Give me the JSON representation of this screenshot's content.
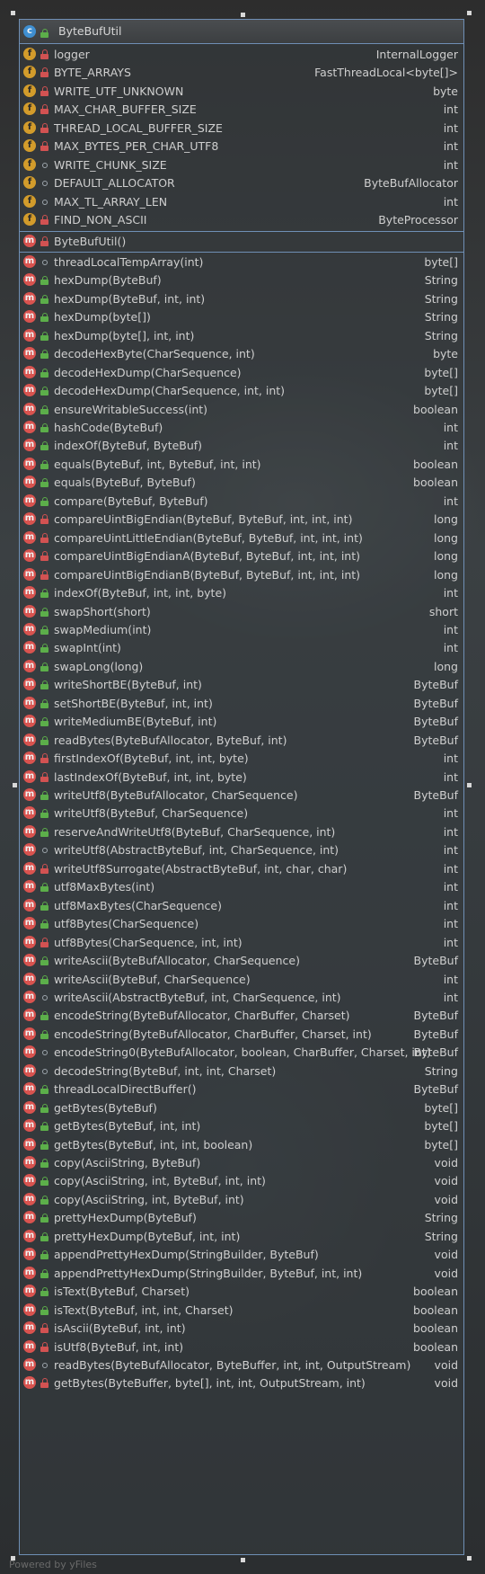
{
  "class_name": "ByteBufUtil",
  "footer_text": "Powered by yFiles",
  "colors": {
    "border": "#6f8fb5",
    "text": "#cfcfcf",
    "field_icon": "#d39c2b",
    "method_icon": "#d9534f",
    "class_icon": "#3f8fd1",
    "public": "#5cae4a",
    "private": "#d25252"
  },
  "fields": [
    {
      "name": "logger",
      "type": "InternalLogger",
      "vis": "private"
    },
    {
      "name": "BYTE_ARRAYS",
      "type": "FastThreadLocal<byte[]>",
      "vis": "private"
    },
    {
      "name": "WRITE_UTF_UNKNOWN",
      "type": "byte",
      "vis": "private"
    },
    {
      "name": "MAX_CHAR_BUFFER_SIZE",
      "type": "int",
      "vis": "private"
    },
    {
      "name": "THREAD_LOCAL_BUFFER_SIZE",
      "type": "int",
      "vis": "private"
    },
    {
      "name": "MAX_BYTES_PER_CHAR_UTF8",
      "type": "int",
      "vis": "private"
    },
    {
      "name": "WRITE_CHUNK_SIZE",
      "type": "int",
      "vis": "package"
    },
    {
      "name": "DEFAULT_ALLOCATOR",
      "type": "ByteBufAllocator",
      "vis": "package"
    },
    {
      "name": "MAX_TL_ARRAY_LEN",
      "type": "int",
      "vis": "package"
    },
    {
      "name": "FIND_NON_ASCII",
      "type": "ByteProcessor",
      "vis": "private"
    }
  ],
  "constructors": [
    {
      "name": "ByteBufUtil()",
      "type": "",
      "vis": "private"
    }
  ],
  "methods": [
    {
      "name": "threadLocalTempArray(int)",
      "type": "byte[]",
      "vis": "package"
    },
    {
      "name": "hexDump(ByteBuf)",
      "type": "String",
      "vis": "public"
    },
    {
      "name": "hexDump(ByteBuf, int, int)",
      "type": "String",
      "vis": "public"
    },
    {
      "name": "hexDump(byte[])",
      "type": "String",
      "vis": "public"
    },
    {
      "name": "hexDump(byte[], int, int)",
      "type": "String",
      "vis": "public"
    },
    {
      "name": "decodeHexByte(CharSequence, int)",
      "type": "byte",
      "vis": "public"
    },
    {
      "name": "decodeHexDump(CharSequence)",
      "type": "byte[]",
      "vis": "public"
    },
    {
      "name": "decodeHexDump(CharSequence, int, int)",
      "type": "byte[]",
      "vis": "public"
    },
    {
      "name": "ensureWritableSuccess(int)",
      "type": "boolean",
      "vis": "public"
    },
    {
      "name": "hashCode(ByteBuf)",
      "type": "int",
      "vis": "public"
    },
    {
      "name": "indexOf(ByteBuf, ByteBuf)",
      "type": "int",
      "vis": "public"
    },
    {
      "name": "equals(ByteBuf, int, ByteBuf, int, int)",
      "type": "boolean",
      "vis": "public"
    },
    {
      "name": "equals(ByteBuf, ByteBuf)",
      "type": "boolean",
      "vis": "public"
    },
    {
      "name": "compare(ByteBuf, ByteBuf)",
      "type": "int",
      "vis": "public"
    },
    {
      "name": "compareUintBigEndian(ByteBuf, ByteBuf, int, int, int)",
      "type": "long",
      "vis": "private"
    },
    {
      "name": "compareUintLittleEndian(ByteBuf, ByteBuf, int, int, int)",
      "type": "long",
      "vis": "private"
    },
    {
      "name": "compareUintBigEndianA(ByteBuf, ByteBuf, int, int, int)",
      "type": "long",
      "vis": "private"
    },
    {
      "name": "compareUintBigEndianB(ByteBuf, ByteBuf, int, int, int)",
      "type": "long",
      "vis": "private"
    },
    {
      "name": "indexOf(ByteBuf, int, int, byte)",
      "type": "int",
      "vis": "public"
    },
    {
      "name": "swapShort(short)",
      "type": "short",
      "vis": "public"
    },
    {
      "name": "swapMedium(int)",
      "type": "int",
      "vis": "public"
    },
    {
      "name": "swapInt(int)",
      "type": "int",
      "vis": "public"
    },
    {
      "name": "swapLong(long)",
      "type": "long",
      "vis": "public"
    },
    {
      "name": "writeShortBE(ByteBuf, int)",
      "type": "ByteBuf",
      "vis": "public"
    },
    {
      "name": "setShortBE(ByteBuf, int, int)",
      "type": "ByteBuf",
      "vis": "public"
    },
    {
      "name": "writeMediumBE(ByteBuf, int)",
      "type": "ByteBuf",
      "vis": "public"
    },
    {
      "name": "readBytes(ByteBufAllocator, ByteBuf, int)",
      "type": "ByteBuf",
      "vis": "public"
    },
    {
      "name": "firstIndexOf(ByteBuf, int, int, byte)",
      "type": "int",
      "vis": "private"
    },
    {
      "name": "lastIndexOf(ByteBuf, int, int, byte)",
      "type": "int",
      "vis": "private"
    },
    {
      "name": "writeUtf8(ByteBufAllocator, CharSequence)",
      "type": "ByteBuf",
      "vis": "public"
    },
    {
      "name": "writeUtf8(ByteBuf, CharSequence)",
      "type": "int",
      "vis": "public"
    },
    {
      "name": "reserveAndWriteUtf8(ByteBuf, CharSequence, int)",
      "type": "int",
      "vis": "public"
    },
    {
      "name": "writeUtf8(AbstractByteBuf, int, CharSequence, int)",
      "type": "int",
      "vis": "package"
    },
    {
      "name": "writeUtf8Surrogate(AbstractByteBuf, int, char, char)",
      "type": "int",
      "vis": "private"
    },
    {
      "name": "utf8MaxBytes(int)",
      "type": "int",
      "vis": "public"
    },
    {
      "name": "utf8MaxBytes(CharSequence)",
      "type": "int",
      "vis": "public"
    },
    {
      "name": "utf8Bytes(CharSequence)",
      "type": "int",
      "vis": "public"
    },
    {
      "name": "utf8Bytes(CharSequence, int, int)",
      "type": "int",
      "vis": "private"
    },
    {
      "name": "writeAscii(ByteBufAllocator, CharSequence)",
      "type": "ByteBuf",
      "vis": "public"
    },
    {
      "name": "writeAscii(ByteBuf, CharSequence)",
      "type": "int",
      "vis": "public"
    },
    {
      "name": "writeAscii(AbstractByteBuf, int, CharSequence, int)",
      "type": "int",
      "vis": "package"
    },
    {
      "name": "encodeString(ByteBufAllocator, CharBuffer, Charset)",
      "type": "ByteBuf",
      "vis": "public"
    },
    {
      "name": "encodeString(ByteBufAllocator, CharBuffer, Charset, int)",
      "type": "ByteBuf",
      "vis": "public"
    },
    {
      "name": "encodeString0(ByteBufAllocator, boolean, CharBuffer, Charset, int)",
      "type": "ByteBuf",
      "vis": "package"
    },
    {
      "name": "decodeString(ByteBuf, int, int, Charset)",
      "type": "String",
      "vis": "package"
    },
    {
      "name": "threadLocalDirectBuffer()",
      "type": "ByteBuf",
      "vis": "public"
    },
    {
      "name": "getBytes(ByteBuf)",
      "type": "byte[]",
      "vis": "public"
    },
    {
      "name": "getBytes(ByteBuf, int, int)",
      "type": "byte[]",
      "vis": "public"
    },
    {
      "name": "getBytes(ByteBuf, int, int, boolean)",
      "type": "byte[]",
      "vis": "public"
    },
    {
      "name": "copy(AsciiString, ByteBuf)",
      "type": "void",
      "vis": "public"
    },
    {
      "name": "copy(AsciiString, int, ByteBuf, int, int)",
      "type": "void",
      "vis": "public"
    },
    {
      "name": "copy(AsciiString, int, ByteBuf, int)",
      "type": "void",
      "vis": "public"
    },
    {
      "name": "prettyHexDump(ByteBuf)",
      "type": "String",
      "vis": "public"
    },
    {
      "name": "prettyHexDump(ByteBuf, int, int)",
      "type": "String",
      "vis": "public"
    },
    {
      "name": "appendPrettyHexDump(StringBuilder, ByteBuf)",
      "type": "void",
      "vis": "public"
    },
    {
      "name": "appendPrettyHexDump(StringBuilder, ByteBuf, int, int)",
      "type": "void",
      "vis": "public"
    },
    {
      "name": "isText(ByteBuf, Charset)",
      "type": "boolean",
      "vis": "public"
    },
    {
      "name": "isText(ByteBuf, int, int, Charset)",
      "type": "boolean",
      "vis": "public"
    },
    {
      "name": "isAscii(ByteBuf, int, int)",
      "type": "boolean",
      "vis": "private"
    },
    {
      "name": "isUtf8(ByteBuf, int, int)",
      "type": "boolean",
      "vis": "private"
    },
    {
      "name": "readBytes(ByteBufAllocator, ByteBuffer, int, int, OutputStream)",
      "type": "void",
      "vis": "package"
    },
    {
      "name": "getBytes(ByteBuffer, byte[], int, int, OutputStream, int)",
      "type": "void",
      "vis": "private"
    }
  ]
}
